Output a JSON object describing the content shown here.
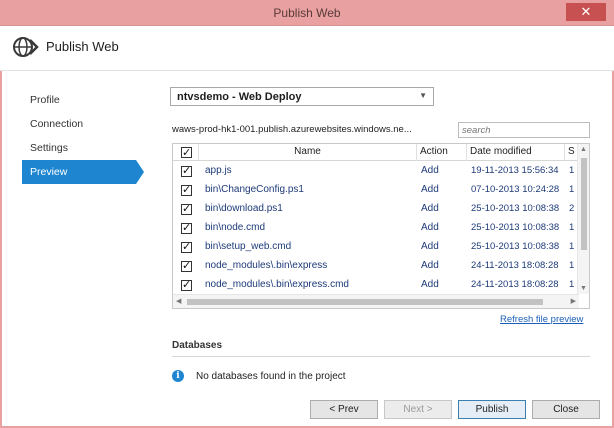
{
  "window": {
    "title": "Publish Web",
    "close_glyph": "✕"
  },
  "header": {
    "title": "Publish Web",
    "icon": "globe-publish-icon"
  },
  "nav": {
    "items": [
      {
        "label": "Profile",
        "active": false
      },
      {
        "label": "Connection",
        "active": false
      },
      {
        "label": "Settings",
        "active": false
      },
      {
        "label": "Preview",
        "active": true
      }
    ]
  },
  "profile_select": {
    "value": "ntvsdemo - Web Deploy"
  },
  "site_url": "waws-prod-hk1-001.publish.azurewebsites.windows.ne...",
  "search": {
    "placeholder": "search"
  },
  "file_grid": {
    "columns": [
      "Name",
      "Action",
      "Date modified",
      "S"
    ],
    "rows": [
      {
        "checked": true,
        "name": "app.js",
        "action": "Add",
        "date": "19-11-2013 15:56:34",
        "size": "1"
      },
      {
        "checked": true,
        "name": "bin\\ChangeConfig.ps1",
        "action": "Add",
        "date": "07-10-2013 10:24:28",
        "size": "1"
      },
      {
        "checked": true,
        "name": "bin\\download.ps1",
        "action": "Add",
        "date": "25-10-2013 10:08:38",
        "size": "2"
      },
      {
        "checked": true,
        "name": "bin\\node.cmd",
        "action": "Add",
        "date": "25-10-2013 10:08:38",
        "size": "1"
      },
      {
        "checked": true,
        "name": "bin\\setup_web.cmd",
        "action": "Add",
        "date": "25-10-2013 10:08:38",
        "size": "1"
      },
      {
        "checked": true,
        "name": "node_modules\\.bin\\express",
        "action": "Add",
        "date": "24-11-2013 18:08:28",
        "size": "1"
      },
      {
        "checked": true,
        "name": "node_modules\\.bin\\express.cmd",
        "action": "Add",
        "date": "24-11-2013 18:08:28",
        "size": "1"
      }
    ]
  },
  "refresh_link": "Refresh file preview",
  "databases": {
    "heading": "Databases",
    "message": "No databases found in the project"
  },
  "buttons": {
    "prev": "< Prev",
    "next": "Next >",
    "publish": "Publish",
    "close": "Close"
  },
  "colors": {
    "titlebar": "#e8a0a0",
    "accent": "#1e86d0",
    "link": "#1c5fb8",
    "grid_text": "#1d3a78"
  }
}
